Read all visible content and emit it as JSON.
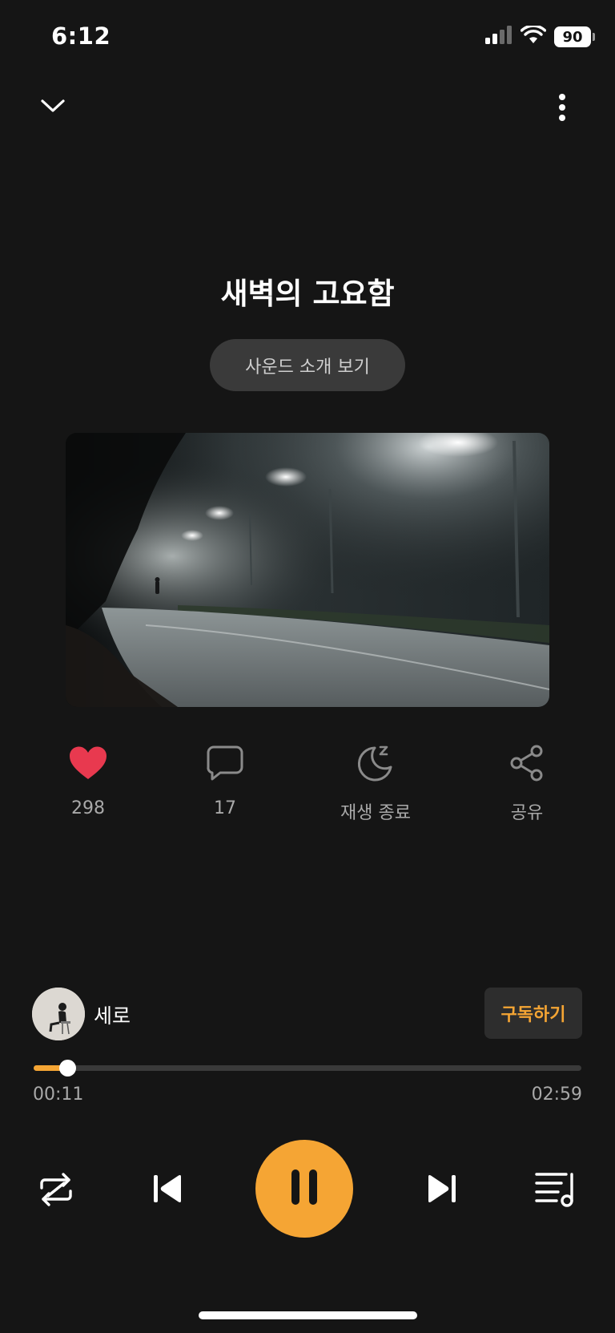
{
  "status_bar": {
    "time": "6:12",
    "battery": "90",
    "icons": [
      "signal-icon",
      "wifi-icon",
      "battery-icon"
    ]
  },
  "header": {
    "icons": [
      "chevron-down-icon",
      "more-vertical-icon"
    ]
  },
  "track": {
    "title": "새벽의 고요함",
    "intro_button": "사운드 소개 보기",
    "artwork": "foggy-street-lights-night-road"
  },
  "actions": [
    {
      "icon": "heart-icon",
      "label": "298",
      "color": "#e8394f"
    },
    {
      "icon": "comment-icon",
      "label": "17"
    },
    {
      "icon": "sleep-timer-icon",
      "label": "재생 종료"
    },
    {
      "icon": "share-icon",
      "label": "공유"
    }
  ],
  "artist": {
    "name": "세로",
    "subscribe_label": "구독하기"
  },
  "player": {
    "elapsed": "00:11",
    "total": "02:59",
    "progress": 0.0614,
    "controls": [
      "repeat-icon",
      "previous-icon",
      "pause-icon",
      "next-icon",
      "playlist-icon"
    ]
  },
  "colors": {
    "background": "#151515",
    "accent": "#f5a534",
    "like": "#e8394f"
  }
}
